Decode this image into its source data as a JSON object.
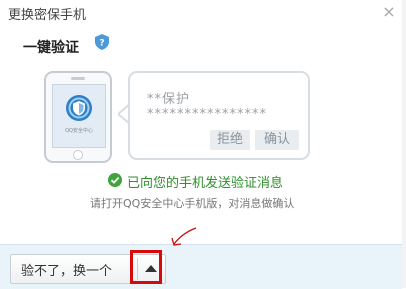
{
  "dialog": {
    "title": "更换密保手机",
    "close_glyph": "×"
  },
  "section": {
    "heading": "一键验证"
  },
  "phone": {
    "screen_caption": "QQ安全中心"
  },
  "message": {
    "line1": "**保护",
    "line2": "****************",
    "reject_label": "拒绝",
    "confirm_label": "确认"
  },
  "status": {
    "text": "已向您的手机发送验证消息",
    "hint": "请打开QQ安全中心手机版，对消息做确认",
    "color": "#2e8f2c"
  },
  "footer": {
    "switch_label": "验不了，换一个"
  },
  "icons": {
    "close": "close-icon",
    "help": "shield-help-icon",
    "check": "check-circle-icon",
    "dropdown": "caret-up-icon"
  },
  "colors": {
    "footer_bg": "#e8f3fa",
    "annotation_red": "#d40b0b"
  }
}
